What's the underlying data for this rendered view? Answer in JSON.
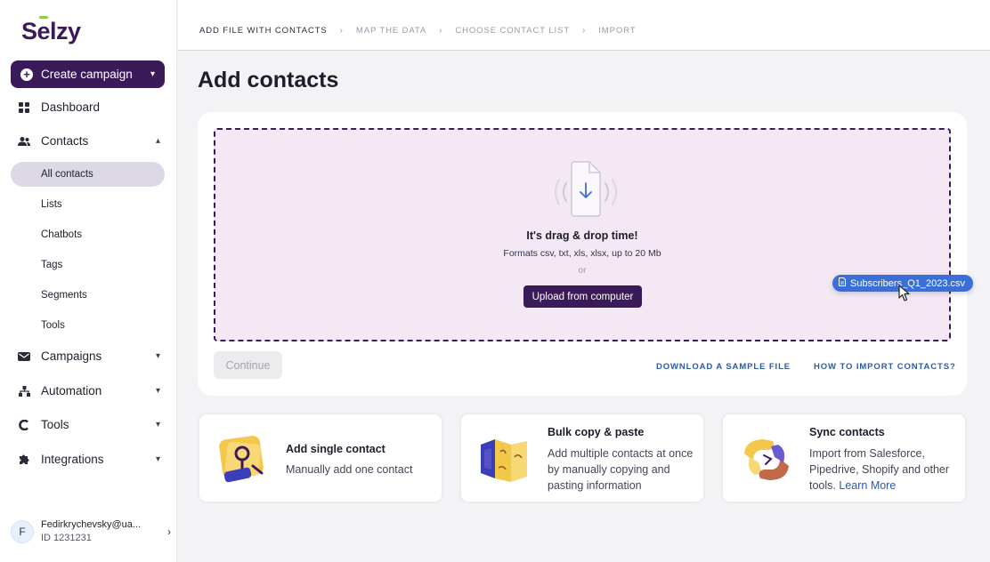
{
  "brand": {
    "logo_text": "Selzy",
    "accent": "#3b1a5a",
    "link_color": "#2d5aa8",
    "chip_color": "#3a6fd8"
  },
  "sidebar": {
    "create_label": "Create campaign",
    "items": [
      {
        "label": "Dashboard",
        "icon": "dashboard-icon"
      },
      {
        "label": "Contacts",
        "icon": "contacts-icon",
        "expanded": true
      },
      {
        "label": "Campaigns",
        "icon": "campaigns-icon"
      },
      {
        "label": "Automation",
        "icon": "automation-icon"
      },
      {
        "label": "Tools",
        "icon": "tools-icon"
      },
      {
        "label": "Integrations",
        "icon": "integrations-icon"
      }
    ],
    "contacts_sub": [
      "All contacts",
      "Lists",
      "Chatbots",
      "Tags",
      "Segments",
      "Tools"
    ],
    "active_sub": "All contacts",
    "user": {
      "initial": "F",
      "email": "Fedirkrychevsky@ua...",
      "id": "ID 1231231"
    }
  },
  "steps": [
    "ADD FILE WITH CONTACTS",
    "MAP THE DATA",
    "CHOOSE CONTACT LIST",
    "IMPORT"
  ],
  "active_step": "ADD FILE WITH CONTACTS",
  "page": {
    "title": "Add contacts"
  },
  "dropzone": {
    "title": "It's drag & drop time!",
    "formats": "Formats csv, txt, xls, xlsx, up to 20 Mb",
    "or": "or",
    "upload_label": "Upload from computer"
  },
  "actions": {
    "continue_label": "Continue",
    "sample_link": "DOWNLOAD A SAMPLE FILE",
    "how_link": "HOW TO IMPORT CONTACTS?"
  },
  "drag_file": {
    "name": "Subscribers_Q1_2023.csv"
  },
  "options": [
    {
      "title": "Add single contact",
      "desc": "Manually add one contact"
    },
    {
      "title": "Bulk copy & paste",
      "desc": "Add multiple contacts at once by manually copying and pasting information"
    },
    {
      "title": "Sync contacts",
      "desc": "Import from Salesforce, Pipedrive, Shopify and other tools.",
      "link": "Learn More"
    }
  ]
}
